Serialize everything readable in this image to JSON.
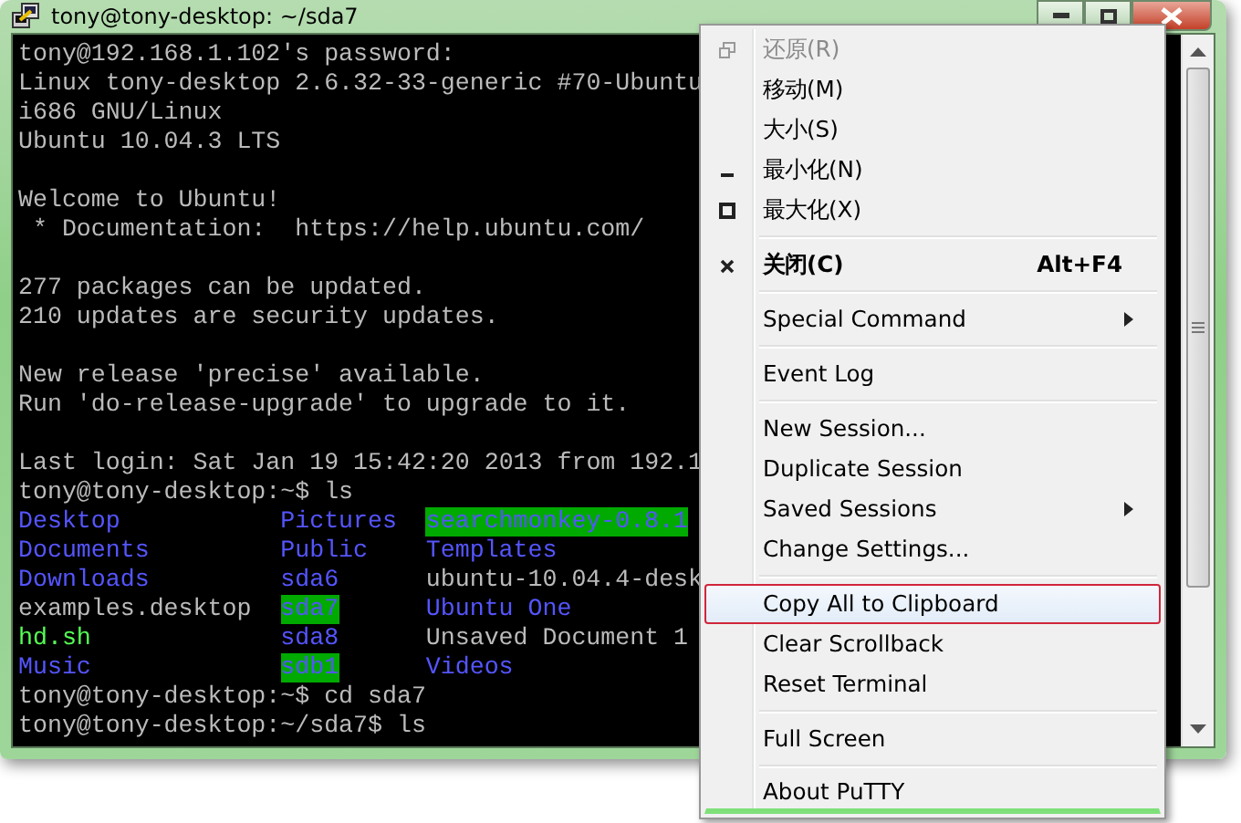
{
  "window": {
    "title": "tony@tony-desktop: ~/sda7"
  },
  "terminal": {
    "blocks": [
      [
        {
          "segments": [
            {
              "text": "tony@192.168.1.102's password:",
              "kind": "plain"
            }
          ]
        },
        {
          "segments": [
            {
              "text": "Linux tony-desktop 2.6.32-33-generic #70-Ubuntu",
              "kind": "plain"
            }
          ]
        },
        {
          "segments": [
            {
              "text": "i686 GNU/Linux",
              "kind": "plain"
            }
          ]
        },
        {
          "segments": [
            {
              "text": "Ubuntu 10.04.3 LTS",
              "kind": "plain"
            }
          ]
        }
      ],
      [
        {
          "segments": [
            {
              "text": "Welcome to Ubuntu!",
              "kind": "plain"
            }
          ]
        },
        {
          "segments": [
            {
              "text": " * Documentation:  https://help.ubuntu.com/",
              "kind": "plain"
            }
          ]
        }
      ],
      [
        {
          "segments": [
            {
              "text": "277 packages can be updated.",
              "kind": "plain"
            }
          ]
        },
        {
          "segments": [
            {
              "text": "210 updates are security updates.",
              "kind": "plain"
            }
          ]
        }
      ],
      [
        {
          "segments": [
            {
              "text": "New release 'precise' available.",
              "kind": "plain"
            }
          ]
        },
        {
          "segments": [
            {
              "text": "Run 'do-release-upgrade' to upgrade to it.",
              "kind": "plain"
            }
          ]
        }
      ],
      [
        {
          "segments": [
            {
              "text": "Last login: Sat Jan 19 15:42:20 2013 from 192.1",
              "kind": "plain"
            }
          ]
        },
        {
          "segments": [
            {
              "text": "tony@tony-desktop:~$ ls",
              "kind": "plain"
            }
          ]
        },
        {
          "columns": [
            {
              "text": "Desktop",
              "kind": "dir"
            },
            {
              "text": "Pictures",
              "kind": "dir"
            },
            {
              "text": "searchmonkey-0.8.1",
              "kind": "highlight"
            }
          ]
        },
        {
          "columns": [
            {
              "text": "Documents",
              "kind": "dir"
            },
            {
              "text": "Public",
              "kind": "dir"
            },
            {
              "text": "Templates",
              "kind": "dir"
            }
          ]
        },
        {
          "columns": [
            {
              "text": "Downloads",
              "kind": "dir"
            },
            {
              "text": "sda6",
              "kind": "dir"
            },
            {
              "text": "ubuntu-10.04.4-desk",
              "kind": "plain"
            }
          ]
        },
        {
          "columns": [
            {
              "text": "examples.desktop",
              "kind": "plain"
            },
            {
              "text": "sda7",
              "kind": "highlight"
            },
            {
              "text": "Ubuntu One",
              "kind": "dir"
            }
          ]
        },
        {
          "columns": [
            {
              "text": "hd.sh",
              "kind": "exec"
            },
            {
              "text": "sda8",
              "kind": "dir"
            },
            {
              "text": "Unsaved Document 1",
              "kind": "plain"
            }
          ]
        },
        {
          "columns": [
            {
              "text": "Music",
              "kind": "dir"
            },
            {
              "text": "sdb1",
              "kind": "highlight"
            },
            {
              "text": "Videos",
              "kind": "dir"
            }
          ]
        },
        {
          "segments": [
            {
              "text": "tony@tony-desktop:~$ cd sda7",
              "kind": "plain"
            }
          ]
        },
        {
          "segments": [
            {
              "text": "tony@tony-desktop:~/sda7$ ls",
              "kind": "plain"
            }
          ]
        }
      ]
    ]
  },
  "menu": {
    "groups": [
      [
        {
          "label": "还原(R)",
          "kind": "restore",
          "disabled": true,
          "selected": false
        },
        {
          "label": "移动(M)",
          "disabled": false,
          "selected": false
        },
        {
          "label": "大小(S)",
          "disabled": false,
          "selected": false
        },
        {
          "label": "最小化(N)",
          "kind": "minimize",
          "disabled": false,
          "selected": false
        },
        {
          "label": "最大化(X)",
          "kind": "maximize",
          "disabled": false,
          "selected": false
        }
      ],
      [
        {
          "label": "关闭(C)",
          "kind": "close",
          "shortcut": "Alt+F4",
          "default": true,
          "disabled": false,
          "selected": false
        }
      ],
      [
        {
          "label": "Special Command",
          "submenu": true,
          "disabled": false,
          "selected": false
        }
      ],
      [
        {
          "label": "Event Log",
          "disabled": false,
          "selected": false
        }
      ],
      [
        {
          "label": "New Session...",
          "disabled": false,
          "selected": false
        },
        {
          "label": "Duplicate Session",
          "disabled": false,
          "selected": false
        },
        {
          "label": "Saved Sessions",
          "submenu": true,
          "disabled": false,
          "selected": false
        },
        {
          "label": "Change Settings...",
          "disabled": false,
          "selected": false
        }
      ],
      [
        {
          "label": "Copy All to Clipboard",
          "disabled": false,
          "selected": true
        },
        {
          "label": "Clear Scrollback",
          "disabled": false,
          "selected": false
        },
        {
          "label": "Reset Terminal",
          "disabled": false,
          "selected": false
        }
      ],
      [
        {
          "label": "Full Screen",
          "disabled": false,
          "selected": false
        }
      ],
      [
        {
          "label": "About PuTTY",
          "disabled": false,
          "selected": false
        }
      ]
    ]
  }
}
